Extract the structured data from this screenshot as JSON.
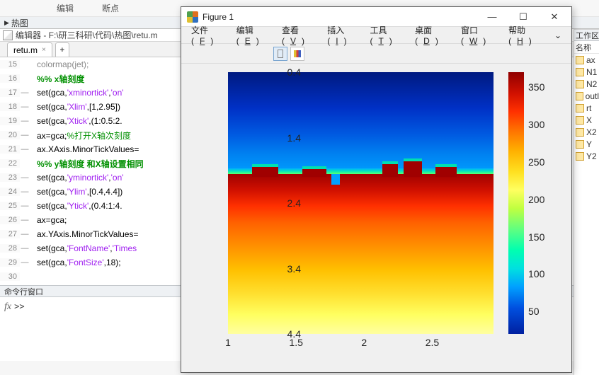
{
  "toolbar": {
    "edit": "编辑",
    "breakpoint": "断点"
  },
  "panels": {
    "heatmap": "热图",
    "cmd": "命令行窗口",
    "workspace": "工作区",
    "name_col": "名称"
  },
  "editor": {
    "title": "编辑器 - F:\\研三科研\\代码\\热图\\retu.m",
    "tab": "retu.m",
    "plus": "+"
  },
  "code": [
    {
      "n": "15",
      "d": "",
      "html": "<span style='color:#888'>colormap(jet);</span>"
    },
    {
      "n": "16",
      "d": "",
      "html": "<span class='kw'>%% x轴刻度</span>"
    },
    {
      "n": "17",
      "d": "—",
      "html": "set(gca,<span class='str'>'xminortick'</span>,<span class='str'>'on'</span>"
    },
    {
      "n": "18",
      "d": "—",
      "html": "set(gca,<span class='str'>'Xlim'</span>,[1,2.95])"
    },
    {
      "n": "19",
      "d": "—",
      "html": "set(gca,<span class='str'>'Xtick'</span>,(1:0.5:2."
    },
    {
      "n": "20",
      "d": "—",
      "html": "ax=gca;<span class='cm'>%打开X轴次刻度</span>"
    },
    {
      "n": "21",
      "d": "—",
      "html": "ax.XAxis.MinorTickValues="
    },
    {
      "n": "22",
      "d": "",
      "html": "<span class='kw'>%% y轴刻度 和X轴设置相同</span>"
    },
    {
      "n": "23",
      "d": "—",
      "html": "set(gca,<span class='str'>'yminortick'</span>,<span class='str'>'on'</span>"
    },
    {
      "n": "24",
      "d": "—",
      "html": "set(gca,<span class='str'>'Ylim'</span>,[0.4,4.4])"
    },
    {
      "n": "25",
      "d": "—",
      "html": "set(gca,<span class='str'>'Ytick'</span>,(0.4:1:4."
    },
    {
      "n": "26",
      "d": "—",
      "html": "ax=gca;"
    },
    {
      "n": "27",
      "d": "—",
      "html": "ax.YAxis.MinorTickValues="
    },
    {
      "n": "28",
      "d": "—",
      "html": "set(gca,<span class='str'>'FontName'</span>,<span class='str'>'Times</span>"
    },
    {
      "n": "29",
      "d": "—",
      "html": "set(gca,<span class='str'>'FontSize'</span>,18);"
    },
    {
      "n": "30",
      "d": "",
      "html": ""
    }
  ],
  "cmd": {
    "fx": "fx",
    "prompt": ">>"
  },
  "vars": [
    "ax",
    "N1",
    "N2",
    "outl",
    "rt",
    "X",
    "X2",
    "Y",
    "Y2"
  ],
  "figure": {
    "title": "Figure 1",
    "menu": [
      [
        "文件",
        "F"
      ],
      [
        "编辑",
        "E"
      ],
      [
        "查看",
        "V"
      ],
      [
        "插入",
        "I"
      ],
      [
        "工具",
        "T"
      ],
      [
        "桌面",
        "D"
      ],
      [
        "窗口",
        "W"
      ],
      [
        "帮助",
        "H"
      ]
    ],
    "help_arrow": "⌄"
  },
  "chart_data": {
    "type": "heatmap",
    "xlabel": "",
    "ylabel": "",
    "xlim": [
      1,
      2.95
    ],
    "ylim": [
      0.4,
      4.4
    ],
    "xticks": [
      1,
      1.5,
      2,
      2.5
    ],
    "yticks": [
      0.4,
      1.4,
      2.4,
      3.4,
      4.4
    ],
    "colorbar": {
      "ticks": [
        50,
        100,
        150,
        200,
        250,
        300,
        350
      ],
      "range": [
        20,
        370
      ]
    },
    "description": "Two-region field: upper cool (~50) for y<~2.0, lower hot (~300→~90 gradient) for y>~2.0, with a ragged transition boundary containing small upward bumps near x≈1.2, 1.55–1.7, 2.15, 2.3, 2.55.",
    "boundary_y_approx": 1.95
  }
}
